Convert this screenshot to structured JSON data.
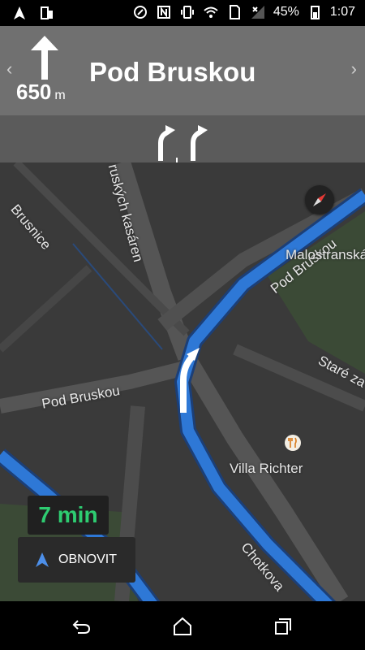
{
  "status_bar": {
    "battery": "45%",
    "time": "1:07",
    "icons": [
      "navigation-icon",
      "screen-cast-icon",
      "nfc-icon",
      "vibrate-icon",
      "wifi-icon",
      "signal-icon",
      "battery-icon"
    ]
  },
  "next_turn": {
    "distance": "650",
    "unit": "m",
    "street": "Pod Bruskou"
  },
  "map_labels": {
    "brusnice": "Brusnice",
    "ruskych_kasaren": "ruských kasáren",
    "pod_bruskou_route": "Pod Bruskou",
    "malostranska": "Malostranská",
    "stare_za": "Staré za",
    "pod_bruskou_street": "Pod Bruskou",
    "villa_richter": "Villa Richter",
    "chotkova": "Chotkova"
  },
  "eta": "7 min",
  "recenter_label": "OBNOVIT",
  "colors": {
    "route": "#2e78d6",
    "eta_text": "#2ecc71",
    "map_bg": "#3a3a3a",
    "road": "#555555",
    "park": "#3b4a36"
  }
}
